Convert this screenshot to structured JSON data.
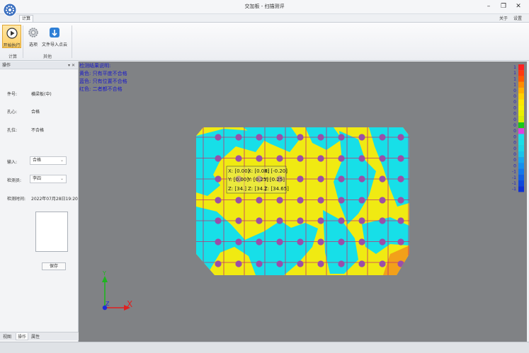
{
  "window": {
    "title": "交加板 - 扫描测评",
    "controls": [
      "minimize-icon",
      "restore-icon",
      "close-icon"
    ]
  },
  "ribbon": {
    "tab": "计算",
    "right_links": [
      "关于",
      "设置"
    ],
    "buttons": [
      {
        "label": "开始执行",
        "icon": "play-icon",
        "active": true
      },
      {
        "label": "选项",
        "icon": "gear-icon",
        "active": false
      },
      {
        "label": "文件导入点云",
        "icon": "import-icon",
        "active": false
      }
    ],
    "groups": [
      "计算",
      "其他"
    ]
  },
  "panel": {
    "title": "操作",
    "fields": [
      {
        "label": "件号:",
        "value": "横梁板(中)"
      },
      {
        "label": "孔心:",
        "value": "合格"
      },
      {
        "label": "孔位:",
        "value": "不合格"
      }
    ],
    "selects": [
      {
        "label": "输入:",
        "value": "合格"
      },
      {
        "label": "检测员:",
        "value": "李四"
      }
    ],
    "date_label": "检测时间:",
    "date_value": "2022年07月28日19:20",
    "save_label": "保存",
    "bottom_tabs": [
      "视图",
      "操作",
      "属性"
    ]
  },
  "viewport": {
    "legend_lines": [
      "检测结果说明:",
      "黄色: 只有平度不合格",
      "蓝色: 只有位置不合格",
      "红色: 二者都不合格"
    ],
    "scale_values": [
      "1",
      "1",
      "1",
      "1",
      "0",
      "0",
      "0",
      "0",
      "0",
      "0",
      "0",
      "0",
      "0",
      "0",
      "0",
      "0",
      "0",
      "0",
      "-1",
      "-1",
      "-1",
      "-1"
    ],
    "tooltip": [
      [
        "X: [0.00]",
        "X: [0.00]",
        "X: [-0.20]"
      ],
      [
        "Y: [0.00]",
        "Y: [0.25]",
        "Y: [0.25]"
      ],
      [
        "Z: [34.]",
        "Z: [34.]",
        "Z: [34.65]"
      ]
    ],
    "axis_labels": {
      "x": "X",
      "y": "Y",
      "z": "Z"
    }
  }
}
